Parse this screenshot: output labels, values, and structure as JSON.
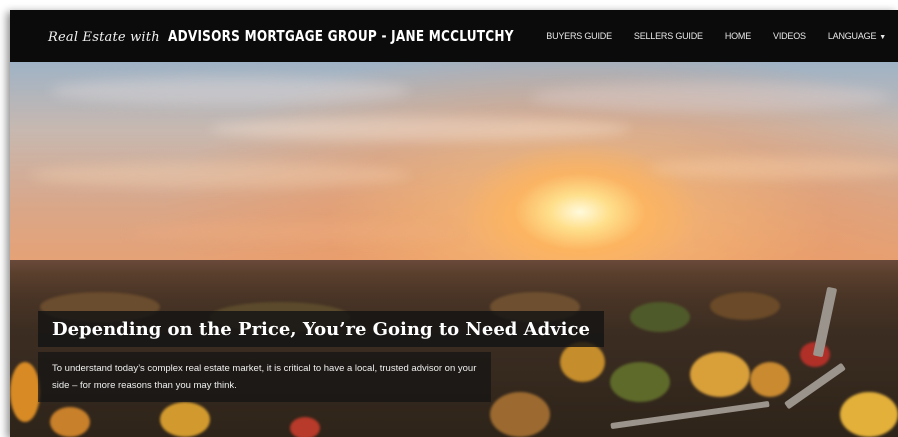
{
  "header": {
    "brand_script": "Real Estate with",
    "brand_main": "ADVISORS MORTGAGE GROUP - JANE MCCLUTCHY"
  },
  "nav": {
    "items": [
      {
        "label": "BUYERS GUIDE"
      },
      {
        "label": "SELLERS GUIDE"
      },
      {
        "label": "HOME"
      },
      {
        "label": "VIDEOS"
      },
      {
        "label": "LANGUAGE"
      }
    ]
  },
  "hero": {
    "headline": "Depending on the Price, You’re Going to Need Advice",
    "description": "To understand today’s complex real estate market, it is critical to have a local, trusted advisor on your side – for more reasons than you may think.",
    "image_description": "Aerial sunset over suburban neighborhood with autumn trees"
  },
  "colors": {
    "nav_bg": "#0b0b0b",
    "nav_text": "#e8e8e8",
    "overlay": "#141414"
  }
}
